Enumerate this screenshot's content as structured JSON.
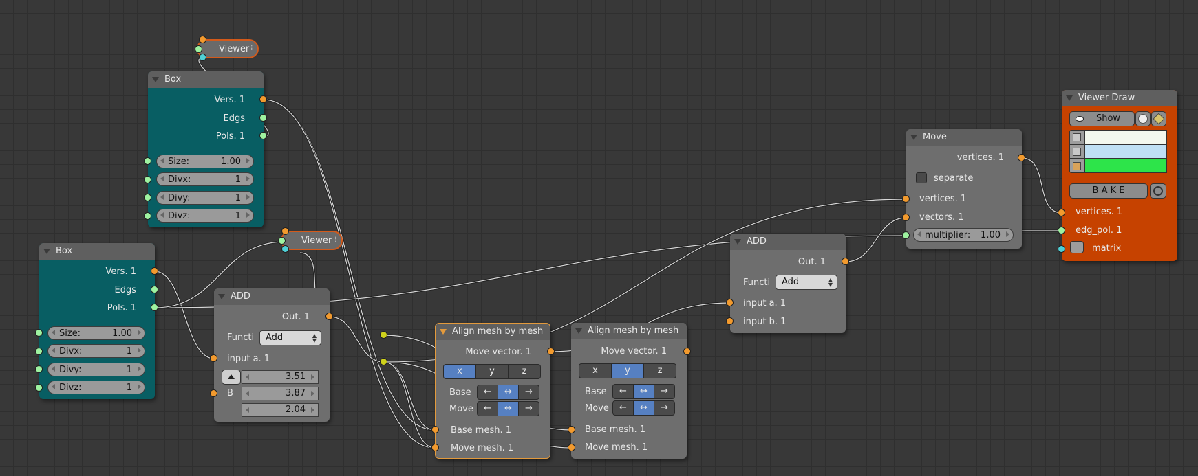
{
  "colors": {
    "background": "#383838",
    "node_gray": "#6e6e6e",
    "node_teal": "#085e63",
    "node_orange": "#c64200",
    "socket_orange": "#f29a2e",
    "socket_green": "#9ef2a0",
    "socket_cyan": "#4fd0d6",
    "socket_yellow": "#cfd21c",
    "active_blue": "#5680c2",
    "selected_outline": "#e39a3c",
    "color_white": "#f3f8ee",
    "color_lightblue": "#bfe0f4",
    "color_green": "#2de44a"
  },
  "icons": {
    "collapse": "triangle-down",
    "eye": "eye-icon",
    "cube": "cube-icon",
    "bake_target": "target-icon",
    "matrix": "matrix-icon",
    "arrow_left": "←",
    "arrow_both": "↔",
    "arrow_right": "→",
    "viewer_grip": "⁞"
  },
  "viewer_top": {
    "title": "Viewer"
  },
  "viewer_mid": {
    "title": "Viewer"
  },
  "box1": {
    "title": "Box",
    "outputs": [
      "Vers. 1",
      "Edgs",
      "Pols. 1"
    ],
    "fields": [
      {
        "label": "Size:",
        "value": "1.00"
      },
      {
        "label": "Divx:",
        "value": "1"
      },
      {
        "label": "Divy:",
        "value": "1"
      },
      {
        "label": "Divz:",
        "value": "1"
      }
    ]
  },
  "box2": {
    "title": "Box",
    "outputs": [
      "Vers. 1",
      "Edgs",
      "Pols. 1"
    ],
    "fields": [
      {
        "label": "Size:",
        "value": "1.00"
      },
      {
        "label": "Divx:",
        "value": "1"
      },
      {
        "label": "Divy:",
        "value": "1"
      },
      {
        "label": "Divz:",
        "value": "1"
      }
    ]
  },
  "add1": {
    "title": "ADD",
    "out": "Out. 1",
    "func_label": "Functi",
    "func_value": "Add",
    "input_a": "input a. 1",
    "input_b": "B",
    "vector": [
      "3.51",
      "3.87",
      "2.04"
    ]
  },
  "align1": {
    "title": "Align mesh by mesh",
    "out": "Move vector. 1",
    "axes": [
      "x",
      "y",
      "z"
    ],
    "active_axis": "x",
    "base_label": "Base",
    "move_label": "Move",
    "base_mesh": "Base mesh. 1",
    "move_mesh": "Move mesh. 1"
  },
  "align2": {
    "title": "Align mesh by mesh",
    "out": "Move vector. 1",
    "axes": [
      "x",
      "y",
      "z"
    ],
    "active_axis": "y",
    "base_label": "Base",
    "move_label": "Move",
    "base_mesh": "Base mesh. 1",
    "move_mesh": "Move mesh. 1"
  },
  "add2": {
    "title": "ADD",
    "out": "Out. 1",
    "func_label": "Functi",
    "func_value": "Add",
    "input_a": "input a. 1",
    "input_b": "input b. 1"
  },
  "move": {
    "title": "Move",
    "out": "vertices. 1",
    "separate": "separate",
    "separate_checked": false,
    "in_vertices": "vertices. 1",
    "in_vectors": "vectors. 1",
    "multiplier_label": "multiplier:",
    "multiplier_value": "1.00"
  },
  "viewer_draw": {
    "title": "Viewer Draw",
    "show": "Show",
    "bake": "B A K E",
    "in_vertices": "vertices. 1",
    "in_edgpol": "edg_pol. 1",
    "in_matrix": "matrix"
  }
}
